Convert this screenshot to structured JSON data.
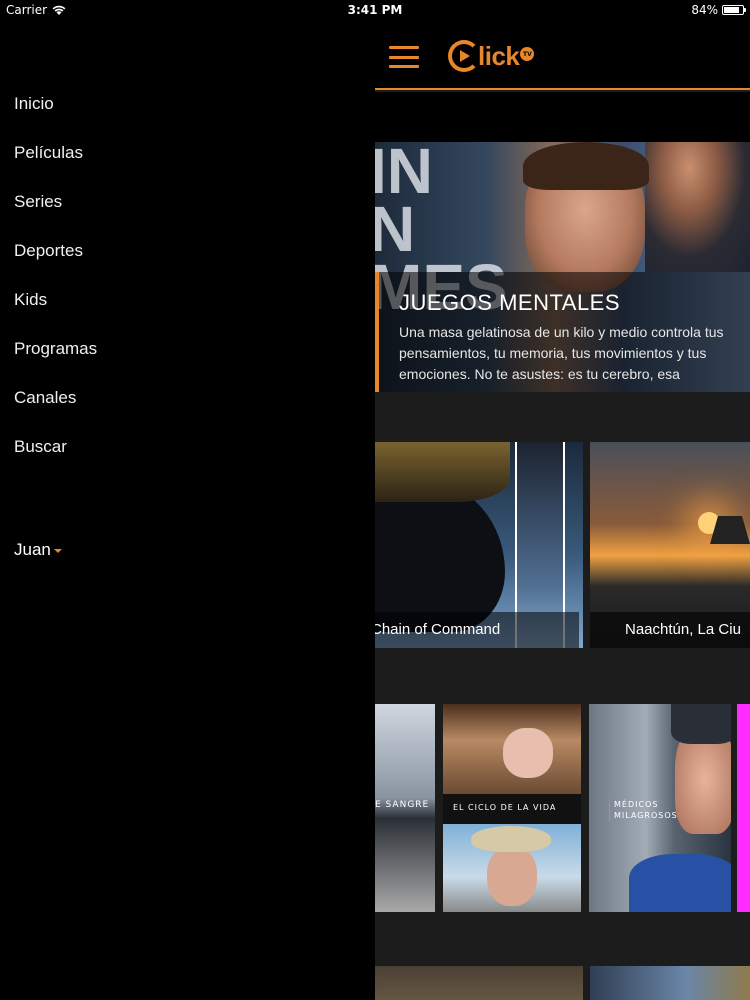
{
  "status_bar": {
    "carrier": "Carrier",
    "time": "3:41 PM",
    "battery": "84%",
    "battery_level": 0.84
  },
  "menu": {
    "items": [
      {
        "label": "Inicio"
      },
      {
        "label": "Películas"
      },
      {
        "label": "Series"
      },
      {
        "label": "Deportes"
      },
      {
        "label": "Kids"
      },
      {
        "label": "Programas"
      },
      {
        "label": "Canales"
      },
      {
        "label": "Buscar"
      }
    ],
    "user": "Juan"
  },
  "header": {
    "logo_text": "lick",
    "logo_badge": "TV"
  },
  "hero": {
    "bg_text": "IN\nN\nMES",
    "title": "JUEGOS MENTALES",
    "description": "Una masa gelatinosa de un kilo y medio controla tus pensamientos, tu memoria, tus movimientos y tus emociones. No te asustes: es tu cerebro, esa"
  },
  "row1": {
    "cards": [
      {
        "title": "Chain of Command"
      },
      {
        "title": "Naachtún, La Ciu"
      }
    ]
  },
  "row2": {
    "cards": [
      {
        "label": "E SANGRE"
      },
      {
        "label": "EL CICLO DE LA VIDA"
      },
      {
        "label_line1": "MÉDICOS",
        "label_line2": "MILAGROSOS"
      }
    ]
  },
  "colors": {
    "accent": "#e8862a",
    "background": "#000000",
    "content_bg": "#1c1c1c"
  }
}
